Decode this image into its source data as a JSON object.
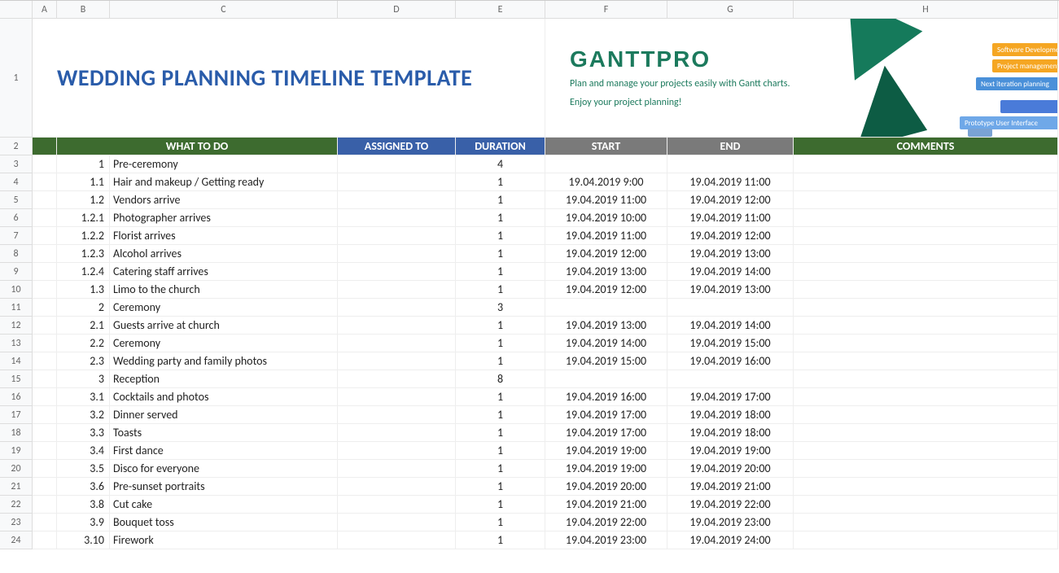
{
  "columns": [
    "A",
    "B",
    "C",
    "D",
    "E",
    "F",
    "G",
    "H"
  ],
  "title": "WEDDING PLANNING TIMELINE TEMPLATE",
  "logo": {
    "name": "GANTTPRO",
    "tagline1": "Plan and manage your projects easily with Gantt charts.",
    "tagline2": "Enjoy your project planning!",
    "bar_labels": [
      "Software Development",
      "Project management",
      "Next iteration planning",
      "Prototype User Interface"
    ]
  },
  "headers": {
    "what": "WHAT TO DO",
    "assigned": "ASSIGNED TO",
    "duration": "DURATION",
    "start": "START",
    "end": "END",
    "comments": "COMMENTS"
  },
  "rows": [
    {
      "n": "3",
      "num": "1",
      "task": "Pre-ceremony",
      "assigned": "",
      "dur": "4",
      "start": "",
      "end": "",
      "c": ""
    },
    {
      "n": "4",
      "num": "1.1",
      "task": "Hair and makeup / Getting ready",
      "assigned": "",
      "dur": "1",
      "start": "19.04.2019 9:00",
      "end": "19.04.2019 11:00",
      "c": ""
    },
    {
      "n": "5",
      "num": "1.2",
      "task": "Vendors arrive",
      "assigned": "",
      "dur": "1",
      "start": "19.04.2019 11:00",
      "end": "19.04.2019 12:00",
      "c": ""
    },
    {
      "n": "6",
      "num": "1.2.1",
      "task": "Photographer arrives",
      "assigned": "",
      "dur": "1",
      "start": "19.04.2019 10:00",
      "end": "19.04.2019 11:00",
      "c": ""
    },
    {
      "n": "7",
      "num": "1.2.2",
      "task": "Florist arrives",
      "assigned": "",
      "dur": "1",
      "start": "19.04.2019 11:00",
      "end": "19.04.2019 12:00",
      "c": ""
    },
    {
      "n": "8",
      "num": "1.2.3",
      "task": "Alcohol arrives",
      "assigned": "",
      "dur": "1",
      "start": "19.04.2019 12:00",
      "end": "19.04.2019 13:00",
      "c": ""
    },
    {
      "n": "9",
      "num": "1.2.4",
      "task": "Catering staff arrives",
      "assigned": "",
      "dur": "1",
      "start": "19.04.2019 13:00",
      "end": "19.04.2019 14:00",
      "c": ""
    },
    {
      "n": "10",
      "num": "1.3",
      "task": "Limo to the church",
      "assigned": "",
      "dur": "1",
      "start": "19.04.2019 12:00",
      "end": "19.04.2019 13:00",
      "c": ""
    },
    {
      "n": "11",
      "num": "2",
      "task": "Ceremony",
      "assigned": "",
      "dur": "3",
      "start": "",
      "end": "",
      "c": ""
    },
    {
      "n": "12",
      "num": "2.1",
      "task": "Guests arrive at church",
      "assigned": "",
      "dur": "1",
      "start": "19.04.2019 13:00",
      "end": "19.04.2019 14:00",
      "c": ""
    },
    {
      "n": "13",
      "num": "2.2",
      "task": "Ceremony",
      "assigned": "",
      "dur": "1",
      "start": "19.04.2019 14:00",
      "end": "19.04.2019 15:00",
      "c": ""
    },
    {
      "n": "14",
      "num": "2.3",
      "task": "Wedding party and family photos",
      "assigned": "",
      "dur": "1",
      "start": "19.04.2019 15:00",
      "end": "19.04.2019 16:00",
      "c": ""
    },
    {
      "n": "15",
      "num": "3",
      "task": "Reception",
      "assigned": "",
      "dur": "8",
      "start": "",
      "end": "",
      "c": ""
    },
    {
      "n": "16",
      "num": "3.1",
      "task": "Cocktails and photos",
      "assigned": "",
      "dur": "1",
      "start": "19.04.2019 16:00",
      "end": "19.04.2019 17:00",
      "c": ""
    },
    {
      "n": "17",
      "num": "3.2",
      "task": "Dinner served",
      "assigned": "",
      "dur": "1",
      "start": "19.04.2019 17:00",
      "end": "19.04.2019 18:00",
      "c": ""
    },
    {
      "n": "18",
      "num": "3.3",
      "task": "Toasts",
      "assigned": "",
      "dur": "1",
      "start": "19.04.2019 17:00",
      "end": "19.04.2019 18:00",
      "c": ""
    },
    {
      "n": "19",
      "num": "3.4",
      "task": "First dance",
      "assigned": "",
      "dur": "1",
      "start": "19.04.2019 19:00",
      "end": "19.04.2019 19:00",
      "c": ""
    },
    {
      "n": "20",
      "num": "3.5",
      "task": "Disco for everyone",
      "assigned": "",
      "dur": "1",
      "start": "19.04.2019 19:00",
      "end": "19.04.2019 20:00",
      "c": ""
    },
    {
      "n": "21",
      "num": "3.6",
      "task": "Pre-sunset portraits",
      "assigned": "",
      "dur": "1",
      "start": "19.04.2019 20:00",
      "end": "19.04.2019 21:00",
      "c": ""
    },
    {
      "n": "22",
      "num": "3.8",
      "task": "Cut cake",
      "assigned": "",
      "dur": "1",
      "start": "19.04.2019 21:00",
      "end": "19.04.2019 22:00",
      "c": ""
    },
    {
      "n": "23",
      "num": "3.9",
      "task": "Bouquet toss",
      "assigned": "",
      "dur": "1",
      "start": "19.04.2019 22:00",
      "end": "19.04.2019 23:00",
      "c": ""
    },
    {
      "n": "24",
      "num": "3.10",
      "task": "Firework",
      "assigned": "",
      "dur": "1",
      "start": "19.04.2019 23:00",
      "end": "19.04.2019 24:00",
      "c": ""
    }
  ]
}
